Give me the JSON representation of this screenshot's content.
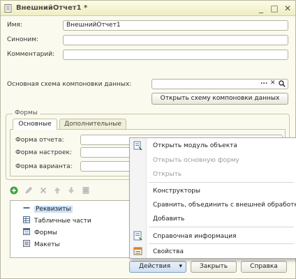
{
  "window": {
    "title": "ВнешнийОтчет1 *",
    "minimize": "_",
    "maximize": "□",
    "close": "✕"
  },
  "fields": {
    "name_label": "Имя:",
    "name_value": "ВнешнийОтчет1",
    "synonym_label": "Синоним:",
    "synonym_value": "",
    "comment_label": "Комментарий:",
    "comment_value": "",
    "schema_label": "Основная схема компоновки данных:",
    "schema_value": "",
    "schema_select": "...",
    "schema_clear": "✕",
    "schema_open_icon": "search-icon",
    "open_schema_button": "Открыть схему компоновки данных"
  },
  "forms_group": {
    "title": "Формы",
    "tabs": [
      "Основные",
      "Дополнительные"
    ],
    "rows": [
      {
        "label": "Форма отчета:",
        "value": ""
      },
      {
        "label": "Форма настроек:",
        "value": ""
      },
      {
        "label": "Форма варианта:",
        "value": ""
      }
    ]
  },
  "toolbar": {
    "icons": [
      "add-icon",
      "edit-icon",
      "delete-icon",
      "move-up-icon",
      "move-down-icon",
      "sort-icon"
    ]
  },
  "tree": {
    "items": [
      {
        "label": "Реквизиты",
        "icon": "attributes-icon",
        "selected": true
      },
      {
        "label": "Табличные части",
        "icon": "table-icon",
        "selected": false
      },
      {
        "label": "Формы",
        "icon": "form-icon",
        "selected": false
      },
      {
        "label": "Макеты",
        "icon": "template-icon",
        "selected": false
      }
    ]
  },
  "context_menu": {
    "items": [
      {
        "label": "Открыть модуль объекта",
        "enabled": true,
        "icon": "module-icon"
      },
      {
        "label": "Открыть основную форму",
        "enabled": false,
        "icon": ""
      },
      {
        "label": "Открыть",
        "enabled": false,
        "icon": ""
      },
      {
        "label": "Конструкторы",
        "enabled": true,
        "icon": ""
      },
      {
        "label": "Сравнить, объединить с внешней обработкой",
        "enabled": true,
        "icon": ""
      },
      {
        "label": "Добавить",
        "enabled": true,
        "icon": ""
      },
      {
        "label": "Справочная информация",
        "enabled": true,
        "icon": "help-icon"
      },
      {
        "label": "Свойства",
        "enabled": true,
        "icon": "properties-icon"
      }
    ]
  },
  "bottom_buttons": {
    "actions": "Действия",
    "actions_arrow": "▾",
    "close": "Закрыть",
    "help": "Справка"
  },
  "colors": {
    "window_bg": "#fbfaef",
    "titlebar": "#efedc4",
    "selection": "#c9e1f7",
    "actions_button": "#dbe8f7"
  }
}
